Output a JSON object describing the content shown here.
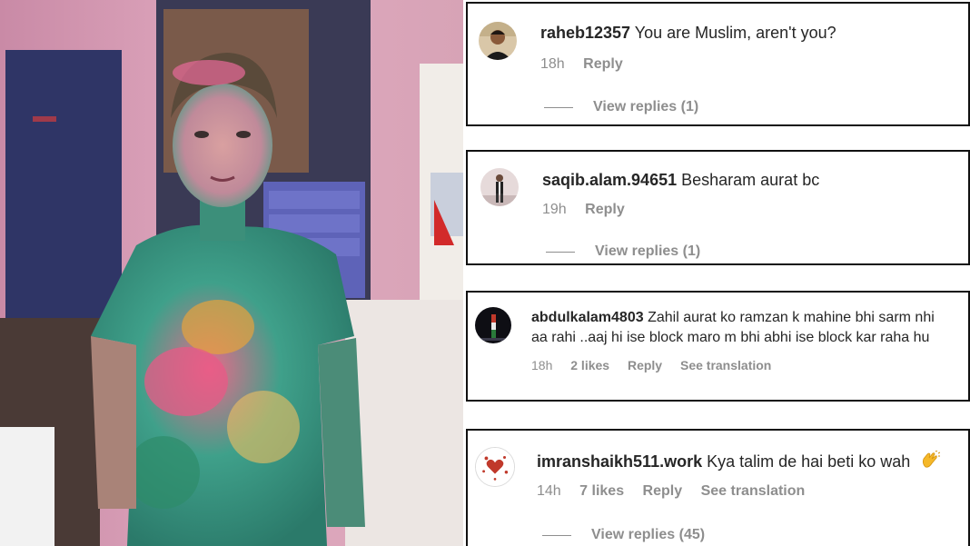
{
  "comments": [
    {
      "username": "raheb12357",
      "text": "You are Muslim, aren't you?",
      "time": "18h",
      "likes": "",
      "reply_label": "Reply",
      "translation_label": "",
      "view_replies": "View replies (1)",
      "avatar": "avatar-man-icon"
    },
    {
      "username": "saqib.alam.94651",
      "text": "Besharam aurat bc",
      "time": "19h",
      "likes": "",
      "reply_label": "Reply",
      "translation_label": "",
      "view_replies": "View replies (1)",
      "avatar": "avatar-standing-man-icon"
    },
    {
      "username": "abdulkalam4803",
      "text": "Zahil aurat ko ramzan k mahine bhi sarm nhi",
      "text_line2": "aa rahi ..aaj hi ise block maro m bhi abhi ise block kar raha hu",
      "time": "18h",
      "likes": "2 likes",
      "reply_label": "Reply",
      "translation_label": "See translation",
      "view_replies": "",
      "avatar": "avatar-tower-icon"
    },
    {
      "username": "imranshaikh511.work",
      "text": "Kya talim de hai beti ko wah",
      "time": "14h",
      "likes": "7 likes",
      "reply_label": "Reply",
      "translation_label": "See translation",
      "view_replies": "View replies (45)",
      "avatar": "avatar-hearts-icon"
    }
  ],
  "colors": {
    "text": "#262626",
    "meta": "#8e8e8e",
    "border": "#111111"
  }
}
